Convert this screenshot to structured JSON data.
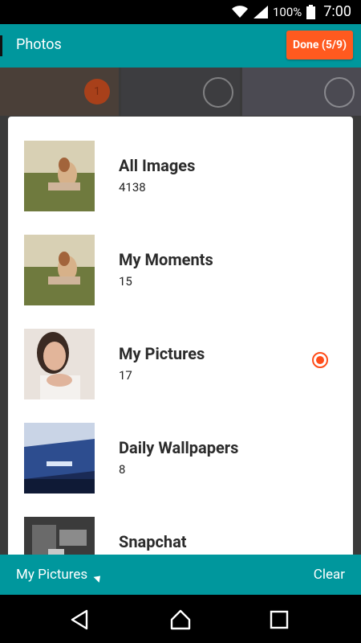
{
  "status": {
    "battery": "100%",
    "time": "7:00"
  },
  "header": {
    "title": "Photos",
    "done_label": "Done (5/9)"
  },
  "background": {
    "badge": "1"
  },
  "albums": [
    {
      "name": "All Images",
      "count": "4138",
      "selected": false,
      "thumb": "outdoor-woman-on-grass"
    },
    {
      "name": "My Moments",
      "count": "15",
      "selected": false,
      "thumb": "outdoor-woman-on-grass"
    },
    {
      "name": "My Pictures",
      "count": "17",
      "selected": true,
      "thumb": "selfie-woman"
    },
    {
      "name": "Daily Wallpapers",
      "count": "8",
      "selected": false,
      "thumb": "blue-wallpaper"
    },
    {
      "name": "Snapchat",
      "count": "",
      "selected": false,
      "thumb": "dark-photo"
    }
  ],
  "footer": {
    "album_selector": "My Pictures",
    "clear_label": "Clear"
  },
  "colors": {
    "teal": "#00979d",
    "accent": "#ff5a1f"
  }
}
